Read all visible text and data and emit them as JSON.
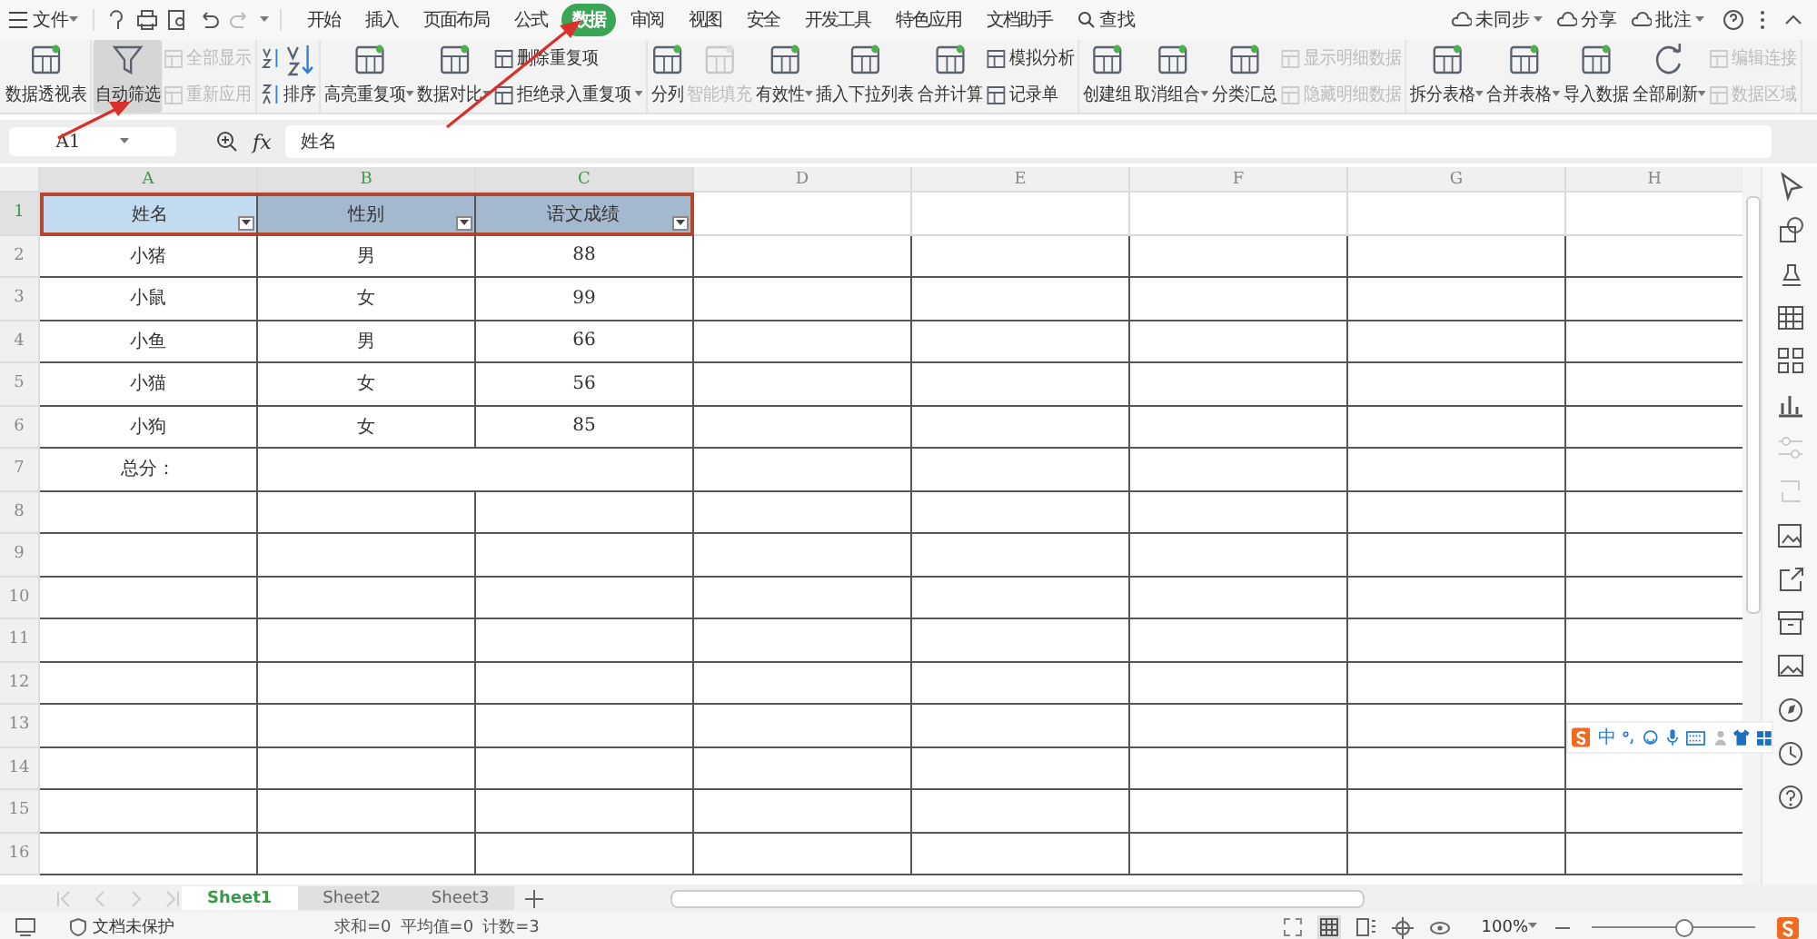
{
  "menu": {
    "file": "文件"
  },
  "tabs": [
    {
      "label": "开始",
      "selected": false
    },
    {
      "label": "插入",
      "selected": false
    },
    {
      "label": "页面布局",
      "selected": false
    },
    {
      "label": "公式",
      "selected": false
    },
    {
      "label": "数据",
      "selected": true
    },
    {
      "label": "审阅",
      "selected": false
    },
    {
      "label": "视图",
      "selected": false
    },
    {
      "label": "安全",
      "selected": false
    },
    {
      "label": "开发工具",
      "selected": false
    },
    {
      "label": "特色应用",
      "selected": false
    },
    {
      "label": "文档助手",
      "selected": false
    }
  ],
  "search": {
    "label": "查找"
  },
  "top_actions": [
    {
      "label": "未同步",
      "menu": true
    },
    {
      "label": "分享",
      "menu": false
    },
    {
      "label": "批注",
      "menu": true
    }
  ],
  "ribbon": [
    {
      "items": [
        {
          "kind": "large",
          "label": "数据透视表",
          "disabled": false,
          "pressed": false,
          "menu": false
        }
      ]
    },
    {
      "items": [
        {
          "kind": "filter",
          "label": "自动筛选",
          "disabled": false,
          "pressed": true,
          "menu": false
        },
        {
          "kind": "small",
          "label": "全部显示",
          "disabled": true,
          "pressed": false,
          "menu": false
        },
        {
          "kind": "small",
          "label": "重新应用",
          "disabled": true,
          "pressed": false,
          "menu": false
        }
      ]
    },
    {
      "items": [
        {
          "kind": "sort-icons"
        },
        {
          "kind": "sort",
          "label": "排序",
          "disabled": false,
          "pressed": false,
          "menu": false
        }
      ]
    },
    {
      "items": [
        {
          "kind": "large",
          "label": "高亮重复项",
          "disabled": false,
          "pressed": false,
          "menu": true
        },
        {
          "kind": "large",
          "label": "数据对比",
          "disabled": false,
          "pressed": false,
          "menu": true
        },
        {
          "kind": "small",
          "label": "删除重复项",
          "disabled": false,
          "pressed": false,
          "menu": false
        },
        {
          "kind": "small",
          "label": "拒绝录入重复项",
          "disabled": false,
          "pressed": false,
          "menu": true
        }
      ]
    },
    {
      "items": [
        {
          "kind": "large",
          "label": "分列",
          "disabled": false,
          "pressed": false,
          "menu": false
        },
        {
          "kind": "large",
          "label": "智能填充",
          "disabled": true,
          "pressed": false,
          "menu": false
        },
        {
          "kind": "large",
          "label": "有效性",
          "disabled": false,
          "pressed": false,
          "menu": true
        },
        {
          "kind": "large",
          "label": "插入下拉列表",
          "disabled": false,
          "pressed": false,
          "menu": false
        },
        {
          "kind": "large",
          "label": "合并计算",
          "disabled": false,
          "pressed": false,
          "menu": false
        },
        {
          "kind": "small",
          "label": "模拟分析",
          "disabled": false,
          "pressed": false,
          "menu": false
        },
        {
          "kind": "small",
          "label": "记录单",
          "disabled": false,
          "pressed": false,
          "menu": false
        }
      ]
    },
    {
      "items": [
        {
          "kind": "large",
          "label": "创建组",
          "disabled": false,
          "pressed": false,
          "menu": false
        },
        {
          "kind": "large",
          "label": "取消组合",
          "disabled": false,
          "pressed": false,
          "menu": true
        },
        {
          "kind": "large",
          "label": "分类汇总",
          "disabled": false,
          "pressed": false,
          "menu": false
        },
        {
          "kind": "small",
          "label": "显示明细数据",
          "disabled": true,
          "pressed": false,
          "menu": false
        },
        {
          "kind": "small",
          "label": "隐藏明细数据",
          "disabled": true,
          "pressed": false,
          "menu": false
        }
      ]
    },
    {
      "items": [
        {
          "kind": "large",
          "label": "拆分表格",
          "disabled": false,
          "pressed": false,
          "menu": true
        },
        {
          "kind": "large",
          "label": "合并表格",
          "disabled": false,
          "pressed": false,
          "menu": true
        },
        {
          "kind": "large",
          "label": "导入数据",
          "disabled": false,
          "pressed": false,
          "menu": false
        },
        {
          "kind": "refresh",
          "label": "全部刷新",
          "disabled": false,
          "pressed": false,
          "menu": true
        },
        {
          "kind": "small",
          "label": "编辑连接",
          "disabled": true,
          "pressed": false,
          "menu": false
        },
        {
          "kind": "small",
          "label": "数据区域",
          "disabled": true,
          "pressed": false,
          "menu": false
        }
      ]
    }
  ],
  "formula_bar": {
    "cell": "A1",
    "function_label": "fx",
    "value": "姓名"
  },
  "sheet": {
    "columns": [
      {
        "label": "A",
        "selected": true
      },
      {
        "label": "B",
        "selected": true
      },
      {
        "label": "C",
        "selected": true
      },
      {
        "label": "D",
        "selected": false
      },
      {
        "label": "E",
        "selected": false
      },
      {
        "label": "F",
        "selected": false
      },
      {
        "label": "G",
        "selected": false
      },
      {
        "label": "H",
        "selected": false
      }
    ],
    "rows": [
      {
        "number": "1",
        "kind": "header",
        "selected": true,
        "cells": [
          {
            "text": "姓名",
            "selected": true
          },
          {
            "text": "性别",
            "selected": false
          },
          {
            "text": "语文成绩",
            "selected": false
          }
        ]
      },
      {
        "number": "2",
        "kind": "data",
        "selected": false,
        "cells": [
          "小猪",
          "男",
          "88"
        ]
      },
      {
        "number": "3",
        "kind": "data",
        "selected": false,
        "cells": [
          "小鼠",
          "女",
          "99"
        ]
      },
      {
        "number": "4",
        "kind": "data",
        "selected": false,
        "cells": [
          "小鱼",
          "男",
          "66"
        ]
      },
      {
        "number": "5",
        "kind": "data",
        "selected": false,
        "cells": [
          "小猫",
          "女",
          "56"
        ]
      },
      {
        "number": "6",
        "kind": "data",
        "selected": false,
        "cells": [
          "小狗",
          "女",
          "85"
        ]
      },
      {
        "number": "7",
        "kind": "merged",
        "selected": false,
        "cells": [
          "总分："
        ]
      },
      {
        "number": "8",
        "kind": "data",
        "selected": false
      },
      {
        "number": "9",
        "kind": "data",
        "selected": false
      },
      {
        "number": "10",
        "kind": "data",
        "selected": false
      },
      {
        "number": "11",
        "kind": "data",
        "selected": false
      },
      {
        "number": "12",
        "kind": "data",
        "selected": false
      },
      {
        "number": "13",
        "kind": "data",
        "selected": false
      },
      {
        "number": "14",
        "kind": "data",
        "selected": false
      },
      {
        "number": "15",
        "kind": "data",
        "selected": false
      },
      {
        "number": "16",
        "kind": "data",
        "selected": false
      }
    ]
  },
  "sheet_tabs": [
    {
      "label": "Sheet1",
      "selected": true
    },
    {
      "label": "Sheet2",
      "selected": false
    },
    {
      "label": "Sheet3",
      "selected": false
    }
  ],
  "status_bar": {
    "protection": "文档未保护",
    "stats": [
      "求和=0",
      "平均值=0",
      "计数=3"
    ],
    "zoom": "100%",
    "zoom_slider": {
      "level": 0.55
    }
  },
  "ime_bar": {
    "mode": "中"
  }
}
